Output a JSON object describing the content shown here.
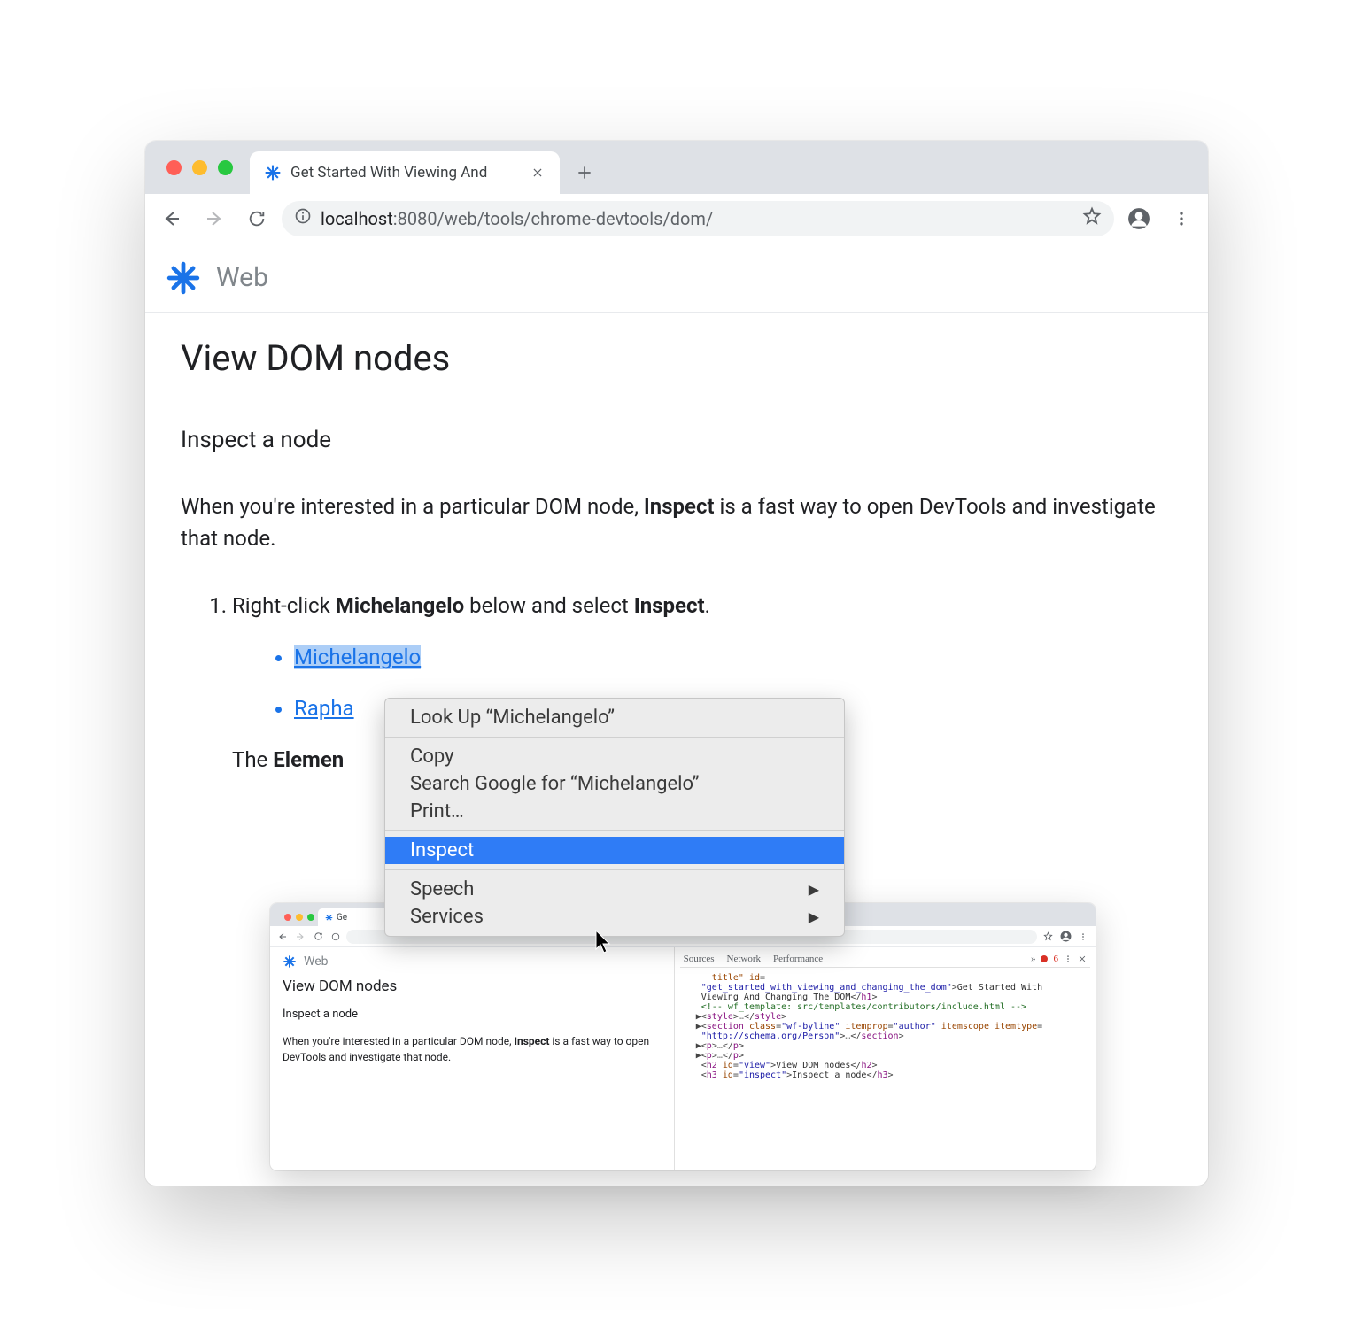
{
  "browser": {
    "tab_title": "Get Started With Viewing And",
    "url_host": "localhost",
    "url_port": ":8080",
    "url_path": "/web/tools/chrome-devtools/dom/"
  },
  "header": {
    "site_title": "Web"
  },
  "page": {
    "h1": "View DOM nodes",
    "h2": "Inspect a node",
    "para_before": "When you're interested in a particular DOM node, ",
    "para_bold": "Inspect",
    "para_after": " is a fast way to open DevTools and investigate that node.",
    "step1_before": "Right-click ",
    "step1_bold1": "Michelangelo",
    "step1_mid": " below and select ",
    "step1_bold2": "Inspect",
    "step1_end": ".",
    "artist1": "Michelangelo",
    "artist2": "Rapha",
    "after_list_before": "The ",
    "after_list_bold": "Elemen"
  },
  "context_menu": {
    "lookup": "Look Up “Michelangelo”",
    "copy": "Copy",
    "search": "Search Google for “Michelangelo”",
    "print": "Print…",
    "inspect": "Inspect",
    "speech": "Speech",
    "services": "Services"
  },
  "nested": {
    "tab_title": "Ge",
    "site_title": "Web",
    "h1": "View DOM nodes",
    "h2": "Inspect a node",
    "para_before": "When you're interested in a particular DOM node, ",
    "para_bold": "Inspect",
    "para_after": " is a fast way to open DevTools and investigate that node.",
    "devtools": {
      "tabs": {
        "sources": "Sources",
        "network": "Network",
        "performance": "Performance",
        "more": "»",
        "err_count": "6"
      }
    }
  }
}
